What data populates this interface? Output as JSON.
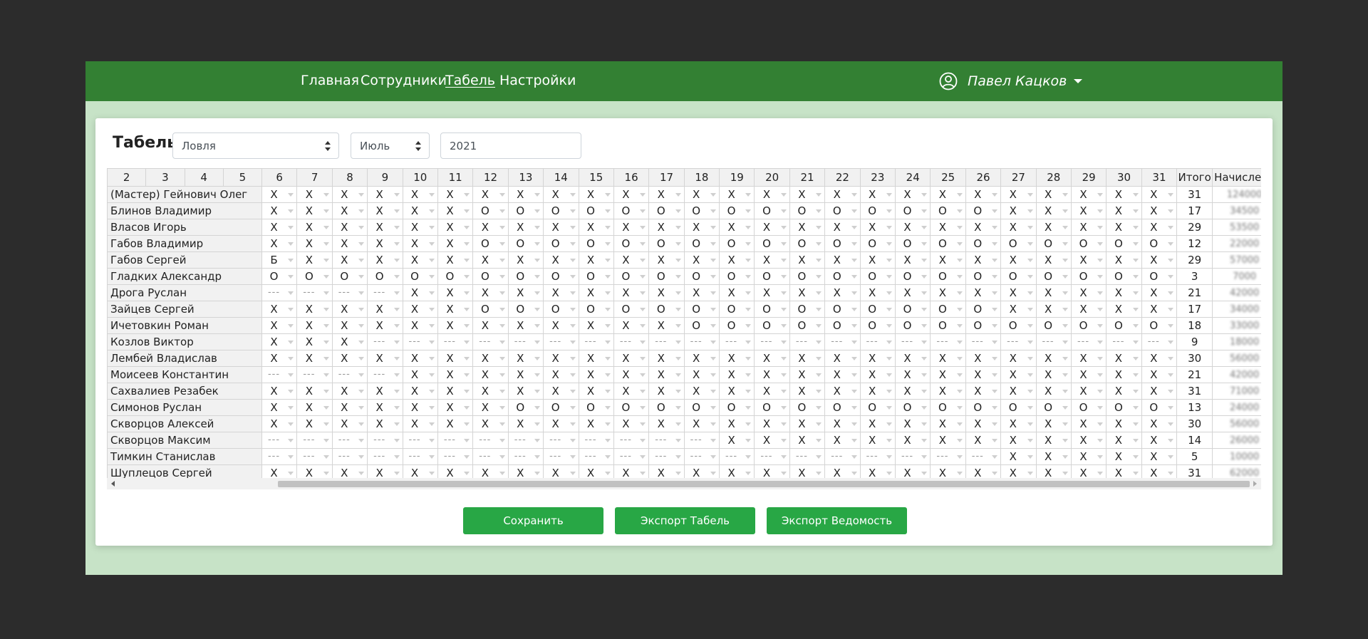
{
  "colors": {
    "navbar": "#338033",
    "page_bg": "#c7e3c7",
    "button": "#28a745",
    "outer_bg": "#2c2c2c"
  },
  "nav": {
    "links": [
      {
        "label": "Главная",
        "active": false
      },
      {
        "label": "Сотрудники",
        "active": false
      },
      {
        "label": "Табель",
        "active": true
      },
      {
        "label": "Настройки",
        "active": false
      }
    ],
    "user": {
      "icon": "user-circle-icon",
      "name": "Павел Кацков"
    }
  },
  "timesheet": {
    "title": "Табель",
    "department": "Ловля",
    "month": "Июль",
    "year": "2021",
    "columns": {
      "days": [
        "2",
        "3",
        "4",
        "5",
        "6",
        "7",
        "8",
        "9",
        "10",
        "11",
        "12",
        "13",
        "14",
        "15",
        "16",
        "17",
        "18",
        "19",
        "20",
        "21",
        "22",
        "23",
        "24",
        "25",
        "26",
        "27",
        "28",
        "29",
        "30",
        "31"
      ],
      "total": "Итого",
      "accrued": "Начислено"
    },
    "rows": [
      {
        "name": "(Мастер) Гейнович Олег",
        "marks": "XXXXXXXXXXXXXXXXXXXXXXXXXX",
        "total": "31",
        "accrued": "124000"
      },
      {
        "name": "Блинов Владимир",
        "marks": "XXXXXXOOOOOOOOOOOOOOOXXXXX",
        "total": "17",
        "accrued": "34500"
      },
      {
        "name": "Власов Игорь",
        "marks": "XXXXXXXXXXXXXXXXXXXXXXXXXX",
        "total": "29",
        "accrued": "53500"
      },
      {
        "name": "Габов Владимир",
        "marks": "XXXXXXOOOOOOOOOOOOOOOOOOOO",
        "total": "12",
        "accrued": "22000"
      },
      {
        "name": "Габов Сергей",
        "marks": "БXXXXXXXXXXXXXXXXXXXXXXXXX",
        "total": "29",
        "accrued": "57000"
      },
      {
        "name": "Гладких Александр",
        "marks": "OOOOOOOOOOOOOOOOOOOOOOOOOO",
        "total": "3",
        "accrued": "7000"
      },
      {
        "name": "Дрога Руслан",
        "marks": "----XXXXXXXXXXXXXXXXXXXXXX",
        "total": "21",
        "accrued": "42000"
      },
      {
        "name": "Зайцев Сергей",
        "marks": "XXXXXXOOOOOOOOOOOOOOOXXXXX",
        "total": "17",
        "accrued": "34000"
      },
      {
        "name": "Ичетовкин Роман",
        "marks": "XXXXXXXXXXXXOOOOOOOOOOOOOO",
        "total": "18",
        "accrued": "33000"
      },
      {
        "name": "Козлов Виктор",
        "marks": "XXX-----------------------",
        "total": "9",
        "accrued": "18000"
      },
      {
        "name": "Лембей Владислав",
        "marks": "XXXXXXXXXXXXXXXXXXXXXXXXXX",
        "total": "30",
        "accrued": "56000"
      },
      {
        "name": "Моисеев Константин",
        "marks": "----XXXXXXXXXXXXXXXXXXXXXX",
        "total": "21",
        "accrued": "42000"
      },
      {
        "name": "Сахвалиев Резабек",
        "marks": "XXXXXXXXXXXXXXXXXXXXXXXXXX",
        "total": "31",
        "accrued": "71000"
      },
      {
        "name": "Симонов Руслан",
        "marks": "XXXXXXXOOOOOOOOOOOOOOOOOOO",
        "total": "13",
        "accrued": "24000"
      },
      {
        "name": "Скворцов Алексей",
        "marks": "XXXXXXXXXXXXXXXXXXXXXXXXXX",
        "total": "30",
        "accrued": "56000"
      },
      {
        "name": "Скворцов Максим",
        "marks": "-------------XXXXXXXXXXXXX",
        "total": "14",
        "accrued": "26000"
      },
      {
        "name": "Тимкин Станислав",
        "marks": "---------------------XXXXX",
        "total": "5",
        "accrued": "10000"
      },
      {
        "name": "Шуплецов Сергей",
        "marks": "XXXXXXXXXXXXXXXXXXXXXXXXXX",
        "total": "31",
        "accrued": "62000"
      }
    ]
  },
  "buttons": {
    "save": "Сохранить",
    "export_timesheet": "Экспорт Табель",
    "export_payroll": "Экспорт Ведомость"
  }
}
